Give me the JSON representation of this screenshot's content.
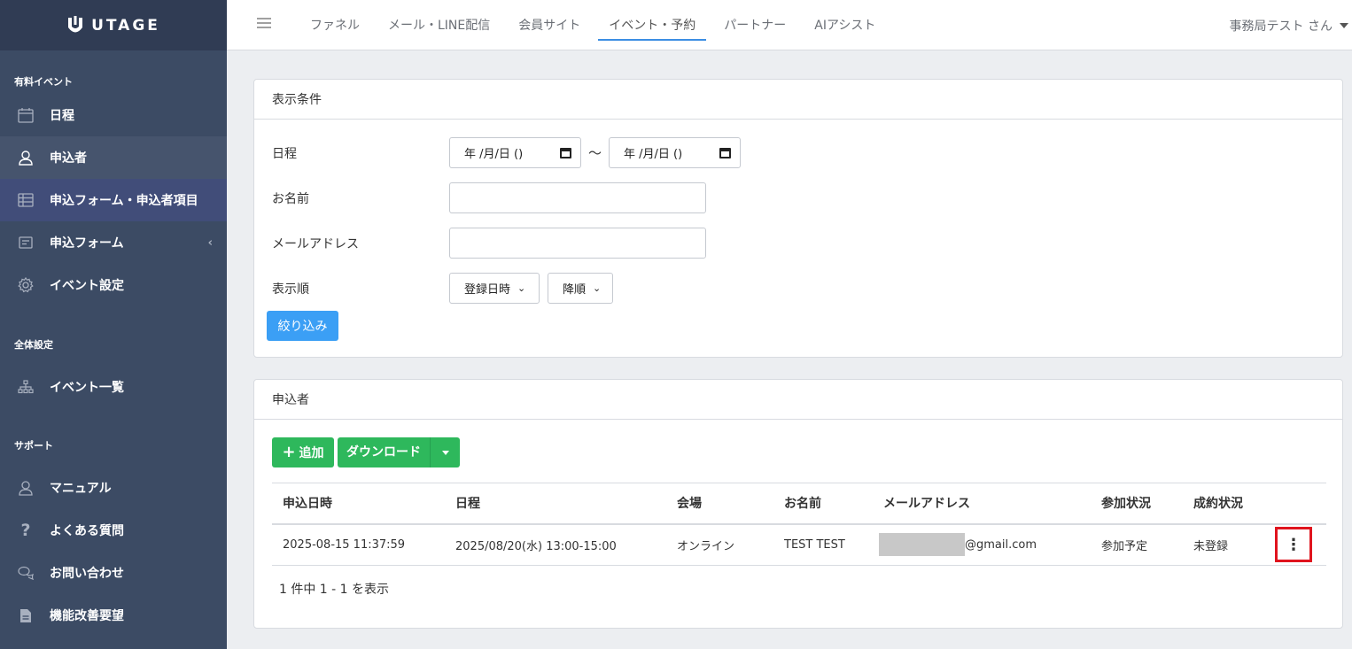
{
  "brand": {
    "name": "UTAGE"
  },
  "sidebar": {
    "sections": [
      {
        "title": "有料イベント"
      },
      {
        "title": "全体設定"
      },
      {
        "title": "サポート"
      }
    ],
    "items": [
      {
        "label": "日程",
        "icon": "calendar-icon"
      },
      {
        "label": "申込者",
        "icon": "user-icon"
      },
      {
        "label": "申込フォーム・申込者項目",
        "icon": "table-icon"
      },
      {
        "label": "申込フォーム",
        "icon": "form-icon",
        "caret": "‹"
      },
      {
        "label": "イベント設定",
        "icon": "gear-icon"
      },
      {
        "label": "イベント一覧",
        "icon": "sitemap-icon"
      },
      {
        "label": "マニュアル",
        "icon": "user-icon"
      },
      {
        "label": "よくある質問",
        "icon": "question-icon"
      },
      {
        "label": "お問い合わせ",
        "icon": "chat-icon"
      },
      {
        "label": "機能改善要望",
        "icon": "document-icon"
      }
    ]
  },
  "topnav": {
    "tabs": [
      {
        "label": "ファネル"
      },
      {
        "label": "メール・LINE配信"
      },
      {
        "label": "会員サイト"
      },
      {
        "label": "イベント・予約",
        "active": true
      },
      {
        "label": "パートナー"
      },
      {
        "label": "AIアシスト"
      }
    ],
    "user": "事務局テスト さん"
  },
  "filter": {
    "title": "表示条件",
    "date_label": "日程",
    "date_from": "年 /月/日 ()",
    "date_sep": "〜",
    "date_to": "年 /月/日 ()",
    "name_label": "お名前",
    "name_value": "",
    "email_label": "メールアドレス",
    "email_value": "",
    "order_label": "表示順",
    "order_field": "登録日時",
    "order_dir": "降順",
    "submit": "絞り込み"
  },
  "applicants": {
    "title": "申込者",
    "add_button": "追加",
    "add_icon": "+",
    "download_button": "ダウンロード",
    "columns": [
      "申込日時",
      "日程",
      "会場",
      "お名前",
      "メールアドレス",
      "参加状況",
      "成約状況"
    ],
    "rows": [
      {
        "applied_at": "2025-08-15 11:37:59",
        "schedule": "2025/08/20(水) 13:00-15:00",
        "venue": "オンライン",
        "name": "TEST TEST",
        "email_suffix": "@gmail.com",
        "attendance": "参加予定",
        "contract": "未登録",
        "menu": "⋮"
      }
    ],
    "pager": "1 件中 1 - 1 を表示"
  }
}
